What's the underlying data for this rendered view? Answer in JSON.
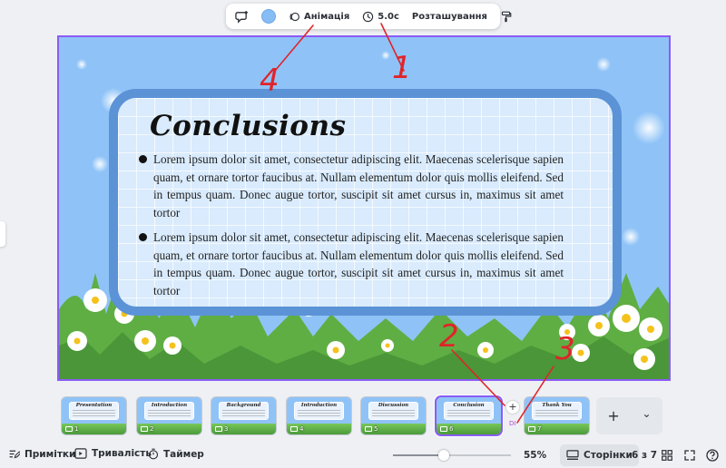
{
  "toolbar": {
    "animation_label": "Анімація",
    "duration_label": "5.0с",
    "position_label": "Розташування",
    "color_swatch": "#87bdf5"
  },
  "slide": {
    "title": "Conclusions",
    "bullets": [
      "Lorem ipsum dolor sit amet, consectetur adipiscing elit. Maecenas scelerisque sapien quam, et ornare tortor faucibus at. Nullam elementum dolor quis mollis eleifend. Sed in tempus quam. Donec augue tortor, suscipit sit amet cursus in, maximus sit amet tortor",
      "Lorem ipsum dolor sit amet, consectetur adipiscing elit. Maecenas scelerisque sapien quam, et ornare tortor faucibus at. Nullam elementum dolor quis mollis eleifend. Sed in tempus quam. Donec augue tortor, suscipit sit amet cursus in, maximus sit amet tortor"
    ],
    "frame_color": "#5b93d6",
    "background_color": "#8fc3f7"
  },
  "thumbnails": [
    {
      "num": "1",
      "title": "Presentation"
    },
    {
      "num": "2",
      "title": "Introduction"
    },
    {
      "num": "3",
      "title": "Background"
    },
    {
      "num": "4",
      "title": "Introduction"
    },
    {
      "num": "5",
      "title": "Discussion"
    },
    {
      "num": "6",
      "title": "Conclusion"
    },
    {
      "num": "7",
      "title": "Thank You"
    }
  ],
  "thumbnail_extra": {
    "add_between": "+",
    "mark": "DI"
  },
  "add_page": {
    "plus": "+",
    "chevron": "⌄"
  },
  "bottombar": {
    "notes_label": "Примітки",
    "duration_label": "Тривалість",
    "timer_label": "Таймер",
    "zoom_value": "55%",
    "zoom_fraction": 0.43,
    "pages_label": "Сторінки",
    "page_count": "6 з 7"
  },
  "annotations": [
    "1",
    "2",
    "3",
    "4"
  ],
  "accent_color": "#8b5cf6",
  "annotation_color": "#e0242a"
}
